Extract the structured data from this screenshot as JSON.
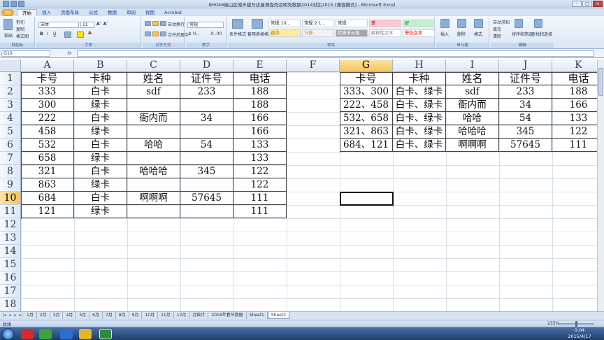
{
  "window": {
    "title": "BH046锡山区城乡建万达苗源壶壳及明壳数据2014对比2015 [兼容模式] - Microsoft Excel"
  },
  "ribbon": {
    "tabs": [
      "开始",
      "插入",
      "页面布局",
      "公式",
      "数据",
      "审阅",
      "视图",
      "Acrobat"
    ],
    "active_tab": "开始",
    "clipboard": {
      "paste": "粘贴",
      "cut": "剪切",
      "copy": "复制",
      "format_painter": "格式刷",
      "group_label": "剪贴板"
    },
    "font": {
      "name": "宋体",
      "size": "11",
      "group_label": "字体"
    },
    "alignment": {
      "wrap": "自动换行",
      "merge": "合并后居中",
      "group_label": "对齐方式"
    },
    "number": {
      "format": "常规",
      "group_label": "数字"
    },
    "styles": {
      "cond_format": "条件格式",
      "table_format": "套用表格格式",
      "cells": [
        {
          "text": "常规 10...",
          "bg": "#ffffff",
          "fg": "#222222"
        },
        {
          "text": "常规 2 1...",
          "bg": "#ffffff",
          "fg": "#222222"
        },
        {
          "text": "常规",
          "bg": "#ffffff",
          "fg": "#222222"
        },
        {
          "text": "差",
          "bg": "#ffc7ce",
          "fg": "#9c0006"
        },
        {
          "text": "好",
          "bg": "#c6efce",
          "fg": "#006100"
        },
        {
          "text": "适中",
          "bg": "#ffeb9c",
          "fg": "#9c6500"
        },
        {
          "text": "计算",
          "bg": "#f2f2f2",
          "fg": "#fa7d00"
        },
        {
          "text": "检查单元格",
          "bg": "#a5a5a5",
          "fg": "#ffffff"
        },
        {
          "text": "解释性文本",
          "bg": "#ffffff",
          "fg": "#7f7f7f"
        },
        {
          "text": "警告文本",
          "bg": "#ffffff",
          "fg": "#ff0000"
        }
      ],
      "group_label": "样式"
    },
    "cells_group": {
      "insert": "插入",
      "delete": "删除",
      "format": "格式",
      "group_label": "单元格"
    },
    "editing": {
      "autosum": "自动求和",
      "fill": "填充",
      "clear": "清除",
      "sort": "排序和筛选",
      "find": "查找和选择",
      "group_label": "编辑"
    }
  },
  "formula_bar": {
    "name_box": "G10",
    "fx": "fx",
    "value": ""
  },
  "grid": {
    "columns": [
      "A",
      "B",
      "C",
      "D",
      "E",
      "F",
      "G",
      "H",
      "I",
      "J",
      "K"
    ],
    "rows": [
      "1",
      "2",
      "3",
      "4",
      "5",
      "6",
      "7",
      "8",
      "9",
      "10",
      "11",
      "12",
      "13",
      "14",
      "15",
      "16",
      "17",
      "18"
    ],
    "selected_column": "G",
    "selected_row": "10",
    "table1": [
      [
        "卡号",
        "卡种",
        "姓名",
        "证件号",
        "电话"
      ],
      [
        "333",
        "白卡",
        "sdf",
        "233",
        "188"
      ],
      [
        "300",
        "绿卡",
        "",
        "",
        "188"
      ],
      [
        "222",
        "白卡",
        "衙内而",
        "34",
        "166"
      ],
      [
        "458",
        "绿卡",
        "",
        "",
        "166"
      ],
      [
        "532",
        "白卡",
        "哈哈",
        "54",
        "133"
      ],
      [
        "658",
        "绿卡",
        "",
        "",
        "133"
      ],
      [
        "321",
        "白卡",
        "哈哈哈",
        "345",
        "122"
      ],
      [
        "863",
        "绿卡",
        "",
        "",
        "122"
      ],
      [
        "684",
        "白卡",
        "啊啊啊",
        "57645",
        "111"
      ],
      [
        "121",
        "绿卡",
        "",
        "",
        "111"
      ]
    ],
    "table2": [
      [
        "卡号",
        "卡种",
        "姓名",
        "证件号",
        "电话"
      ],
      [
        "333、300",
        "白卡、绿卡",
        "sdf",
        "233",
        "188"
      ],
      [
        "222、458",
        "白卡、绿卡",
        "衙内而",
        "34",
        "166"
      ],
      [
        "532、658",
        "白卡、绿卡",
        "哈哈",
        "54",
        "133"
      ],
      [
        "321、863",
        "白卡、绿卡",
        "哈哈哈",
        "345",
        "122"
      ],
      [
        "684、121",
        "白卡、绿卡",
        "啊啊啊",
        "57645",
        "111"
      ]
    ]
  },
  "sheets": [
    "1月",
    "2月",
    "3月",
    "4月",
    "5月",
    "6月",
    "7月",
    "8月",
    "9月",
    "10月",
    "11月",
    "12月",
    "月统计",
    "2016年春节数据",
    "Sheet1",
    "Sheet2"
  ],
  "active_sheet": "Sheet2",
  "status": {
    "ready": "就绪",
    "zoom": "235%"
  },
  "taskbar": {
    "time": "0:04",
    "date": "2015/4/17"
  }
}
